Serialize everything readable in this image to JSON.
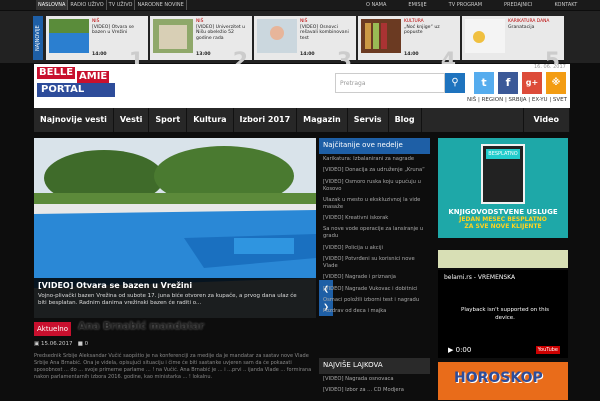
{
  "topbar": {
    "left": [
      "NASLOVNA",
      "RADIO UŽIVO",
      "TV UŽIVO",
      "NARODNE NOVINE"
    ],
    "right": [
      "O NAMA",
      "EMISIJE",
      "TV PROGRAM",
      "PREDAJNICI",
      "KONTAKT"
    ]
  },
  "strip": {
    "label": "NAJNOVIJE",
    "cards": [
      {
        "cat": "NIŠ",
        "title": "[VIDEO] Otvara se bazen u Vrežini",
        "time": "14:00",
        "num": "1"
      },
      {
        "cat": "NIŠ",
        "title": "[VIDEO] Univerzitet u Nišu obeležio 52 godine rada",
        "time": "13:00",
        "num": "2"
      },
      {
        "cat": "NIŠ",
        "title": "[VIDEO] Osnovci rešavali kombinovani test",
        "time": "14:00",
        "num": "3"
      },
      {
        "cat": "KULTURA",
        "title": "„Noć knjige“ uz popuste",
        "time": "14:00",
        "num": "4"
      },
      {
        "cat": "KARIKATURA DANA",
        "title": "Granatacija",
        "time": "",
        "num": "5"
      }
    ]
  },
  "header": {
    "logo1": "BELLE",
    "logo2": "AMIE",
    "logo3": "PORTAL",
    "search_placeholder": "Pretraga",
    "date": "16. 06. 2017",
    "lang": "NIŠ | REGION | SRBIJA | EX-YU | SVET"
  },
  "nav": [
    "Najnovije vesti",
    "Vesti",
    "Sport",
    "Kultura",
    "Izbori 2017",
    "Magazin",
    "Servis",
    "Blog"
  ],
  "nav_video": "Video",
  "featured": {
    "title": "[VIDEO] Otvara se bazen u Vrežini",
    "desc": "Vojno-plivački bazen Vrežina od subote 17. juna biće otvoren za kupače, a prvog dana ulaz će biti besplatan. Radnim danima vrežinski bazen će raditi o..."
  },
  "aktuelno": {
    "badge": "Aktuelno",
    "title": "Ana Brnabić mandatar",
    "date": "15.06.2017",
    "comments": "0",
    "body": "Predsednik Srbije Aleksandar Vučić saopštio je na konferenciji za medije da je mandatar za sastav nove Vlade Srbije Ana Brnabić. Ona je videla, opisujući situaciju i čime će biti sastanke uvjeren sam da će pokazati sposobnost ... do ... svoje primerne parlame ... ! na Vučić. Ana Brnabić je ... i ...prvi .. ijanda Vlade ... formirana nakon parlamentarnih izbora 2016. godine, kao ministarka ... ! lokalnu."
  },
  "middle": {
    "head1": "Najčitanije ove nedelje",
    "items": [
      "Karikatura: Izbalanirani za nagrade",
      "[VIDEO] Donacija za udruženje „Kruna“",
      "[VIDEO] Osmoro ruska koju upućuju u Kosovo",
      "Ulazak u mesto u ekskluzivnoj la vide masaže",
      "[VIDEO] Kreativni iskorak",
      "Sa nove vode operacije za lansiranje u gradu",
      "[VIDEO] Policija u akciji",
      "[VIDEO] Potvrđeni su korisnici nove Vlade",
      "[VIDEO] Nagrade i priznanja",
      "[VIDEO] Nagrade Vukovac i dobitnici",
      "Osmaci položili izborni test i nagradu",
      "Pozdrav od deca i majka"
    ],
    "head2": "NAJVIŠE LAJKOVA",
    "items2": [
      "[VIDEO] Nagrada osnovaca",
      "[VIDEO] Izbor za ... CD Modjera"
    ]
  },
  "right": {
    "calc_label": "BESPLATNO",
    "ad_line1": "KNJIGOVODSTVENE USLUGE",
    "ad_line2": "JEDAN MESEC BESPLATNO",
    "ad_line3": "ZA SVE NOVE KLIJENTE",
    "video_title": "belami.rs - VREMENSKA",
    "video_msg": "Playback isn't supported on this device.",
    "video_time": "0:00",
    "yt": "YouTube",
    "horoscope": "HOROSKOP"
  },
  "colors": {
    "accent": "#1e5fa6",
    "red": "#c8102e",
    "bg": "#0d0d0d"
  }
}
